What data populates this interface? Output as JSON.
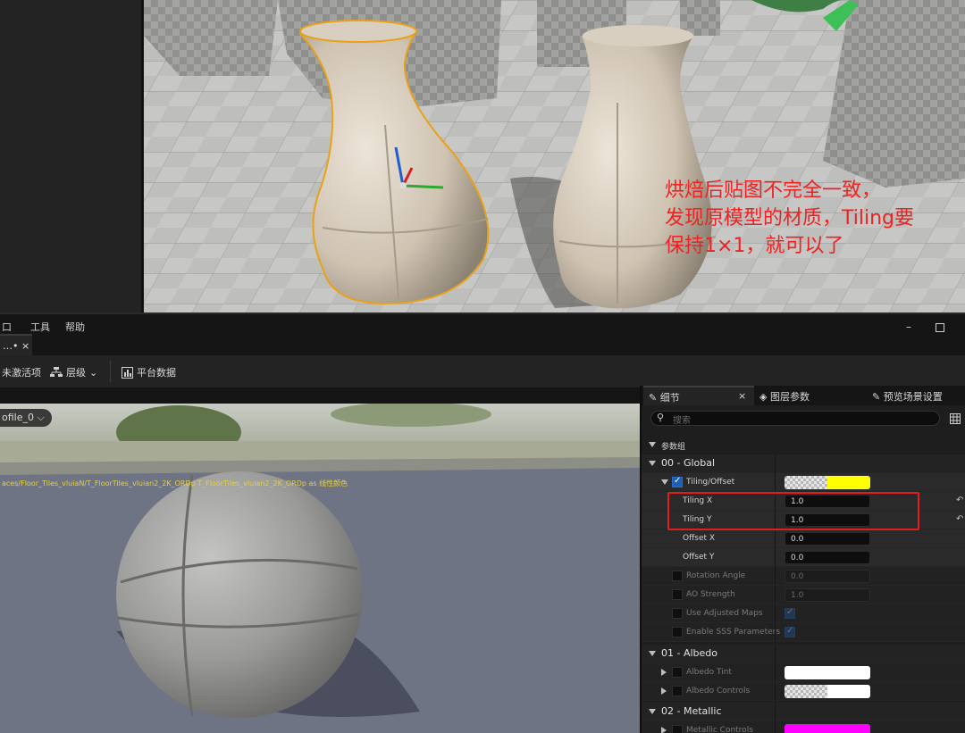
{
  "annotation": {
    "text": "烘焙后贴图不完全一致，\n发现原模型的材质，Tiling要\n保持1×1，就可以了"
  },
  "menu": {
    "items": [
      "口",
      "工具",
      "帮助"
    ],
    "minimize": "–"
  },
  "document_tab": {
    "label": "…• ×"
  },
  "toolbar": {
    "live_update": "未激活项",
    "hierarchy": "层级",
    "platform_stats": "平台数据"
  },
  "preview": {
    "profile": "ofile_0 ⌵",
    "texture_path": "aces/Floor_Tiles_vluiaN/T_FloorTiles_vluian2_2K_ORDp T_FloorTiles_vluian2_2K_ORDp as 线性颜色"
  },
  "details": {
    "tabs": {
      "details": "细节",
      "details_close": "×",
      "layer_params": "图层参数",
      "preview_scene": "预览场景设置"
    },
    "search_placeholder": "搜索",
    "group_header": "参数组",
    "categories": {
      "global": "00 - Global",
      "albedo": "01 - Albedo",
      "metallic": "02 - Metallic"
    },
    "tiling_offset": {
      "label": "Tiling/Offset",
      "swatch_color": "#ffff00"
    },
    "params": [
      {
        "label": "Tiling X",
        "value": "1.0"
      },
      {
        "label": "Tiling Y",
        "value": "1.0"
      },
      {
        "label": "Offset X",
        "value": "0.0"
      },
      {
        "label": "Offset Y",
        "value": "0.0"
      },
      {
        "label": "Rotation Angle",
        "value": "0.0"
      },
      {
        "label": "AO Strength",
        "value": "1.0"
      },
      {
        "label": "Use Adjusted Maps"
      },
      {
        "label": "Enable SSS Parameters"
      }
    ],
    "albedo_params": [
      {
        "label": "Albedo Tint",
        "swatch_color": "#ffffff"
      },
      {
        "label": "Albedo Controls",
        "swatch_color": "#ffffff"
      }
    ],
    "metallic_params": [
      {
        "label": "Metallic Controls",
        "swatch_color": "#ff00ff"
      }
    ]
  },
  "colors": {
    "annotation": "#ee2222",
    "highlight_box": "#e01e1e",
    "selection_outline": "#e8a21a",
    "accent_blue": "#1d5fb6"
  }
}
